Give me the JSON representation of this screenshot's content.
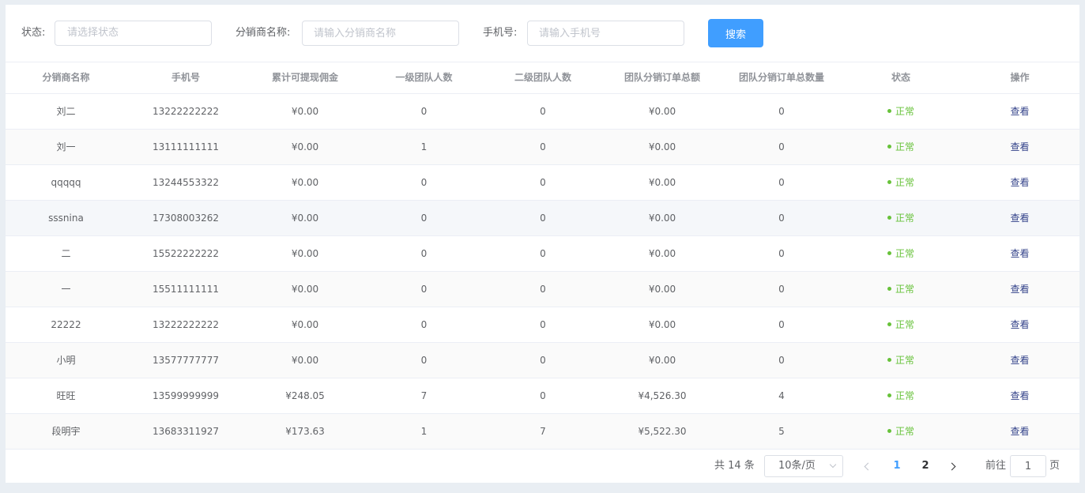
{
  "filters": {
    "status_label": "状态:",
    "status_placeholder": "请选择状态",
    "name_label": "分销商名称:",
    "name_placeholder": "请输入分销商名称",
    "phone_label": "手机号:",
    "phone_placeholder": "请输入手机号",
    "search_label": "搜索"
  },
  "table": {
    "columns": [
      "分销商名称",
      "手机号",
      "累计可提现佣金",
      "一级团队人数",
      "二级团队人数",
      "团队分销订单总额",
      "团队分销订单总数量",
      "状态",
      "操作"
    ],
    "rows": [
      {
        "name": "刘二",
        "phone": "13222222222",
        "commission": "¥0.00",
        "level1": "0",
        "level2": "0",
        "order_total": "¥0.00",
        "order_count": "0",
        "status": "正常",
        "action": "查看"
      },
      {
        "name": "刘一",
        "phone": "13111111111",
        "commission": "¥0.00",
        "level1": "1",
        "level2": "0",
        "order_total": "¥0.00",
        "order_count": "0",
        "status": "正常",
        "action": "查看"
      },
      {
        "name": "qqqqq",
        "phone": "13244553322",
        "commission": "¥0.00",
        "level1": "0",
        "level2": "0",
        "order_total": "¥0.00",
        "order_count": "0",
        "status": "正常",
        "action": "查看"
      },
      {
        "name": "sssnina",
        "phone": "17308003262",
        "commission": "¥0.00",
        "level1": "0",
        "level2": "0",
        "order_total": "¥0.00",
        "order_count": "0",
        "status": "正常",
        "action": "查看"
      },
      {
        "name": "二",
        "phone": "15522222222",
        "commission": "¥0.00",
        "level1": "0",
        "level2": "0",
        "order_total": "¥0.00",
        "order_count": "0",
        "status": "正常",
        "action": "查看"
      },
      {
        "name": "一",
        "phone": "15511111111",
        "commission": "¥0.00",
        "level1": "0",
        "level2": "0",
        "order_total": "¥0.00",
        "order_count": "0",
        "status": "正常",
        "action": "查看"
      },
      {
        "name": "22222",
        "phone": "13222222222",
        "commission": "¥0.00",
        "level1": "0",
        "level2": "0",
        "order_total": "¥0.00",
        "order_count": "0",
        "status": "正常",
        "action": "查看"
      },
      {
        "name": "小明",
        "phone": "13577777777",
        "commission": "¥0.00",
        "level1": "0",
        "level2": "0",
        "order_total": "¥0.00",
        "order_count": "0",
        "status": "正常",
        "action": "查看"
      },
      {
        "name": "旺旺",
        "phone": "13599999999",
        "commission": "¥248.05",
        "level1": "7",
        "level2": "0",
        "order_total": "¥4,526.30",
        "order_count": "4",
        "status": "正常",
        "action": "查看"
      },
      {
        "name": "段明宇",
        "phone": "13683311927",
        "commission": "¥173.63",
        "level1": "1",
        "level2": "7",
        "order_total": "¥5,522.30",
        "order_count": "5",
        "status": "正常",
        "action": "查看"
      }
    ]
  },
  "pagination": {
    "total_text": "共 14 条",
    "page_size": "10条/页",
    "pages": [
      "1",
      "2"
    ],
    "current_page": "1",
    "goto_label": "前往",
    "goto_value": "1",
    "goto_suffix": "页"
  },
  "colors": {
    "primary": "#409eff",
    "success": "#67c23a",
    "link": "#34438a"
  }
}
